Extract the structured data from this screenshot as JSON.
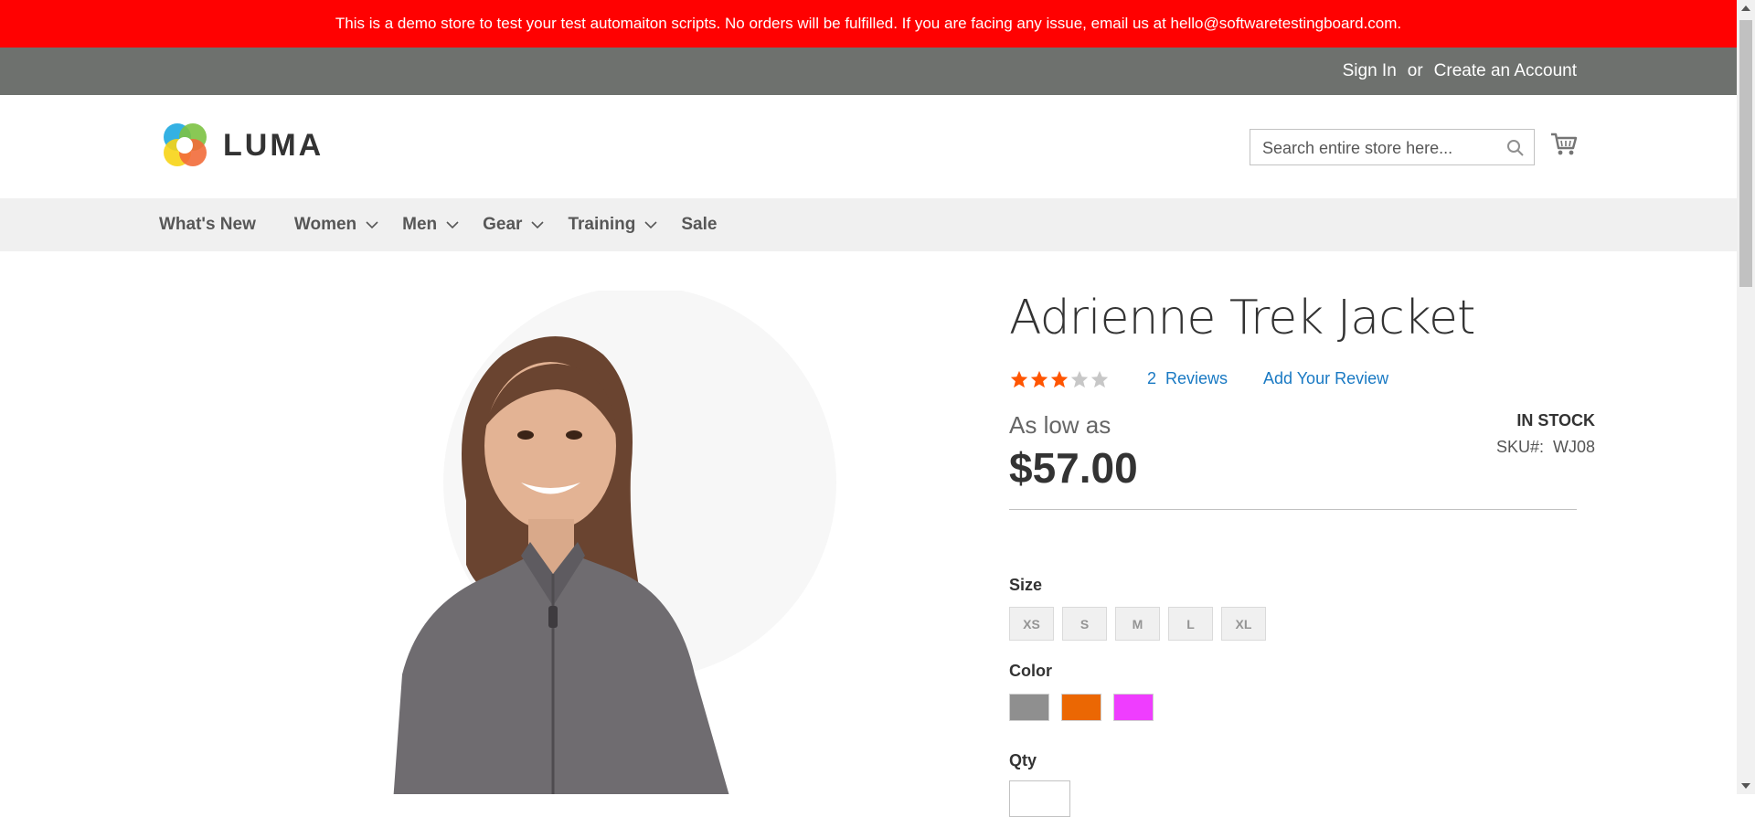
{
  "banner": {
    "text": "This is a demo store to test your test automaiton scripts. No orders will be fulfilled. If you are facing any issue, email us at hello@softwaretestingboard.com.",
    "bg_color": "#ff0101"
  },
  "top_bar": {
    "sign_in": "Sign In",
    "or": "or",
    "create_account": "Create an Account",
    "bg_color": "#6e716e"
  },
  "header": {
    "logo_text": "LUMA",
    "search": {
      "placeholder": "Search entire store here..."
    },
    "icons": [
      "luma-logo-icon",
      "search-icon",
      "cart-icon"
    ]
  },
  "nav": {
    "items": [
      {
        "label": "What's New"
      },
      {
        "label": "Women"
      },
      {
        "label": "Men"
      },
      {
        "label": "Gear"
      },
      {
        "label": "Training"
      },
      {
        "label": "Sale"
      }
    ]
  },
  "product": {
    "title": "Adrienne Trek Jacket",
    "rating": {
      "filled": 3,
      "out_of": 5,
      "star_color": "#ff5501"
    },
    "reviews_count": "2",
    "reviews_label": "Reviews",
    "add_review": "Add Your Review",
    "as_low_as": "As low as",
    "price": "$57.00",
    "stock": "In stock",
    "sku_label": "SKU#:",
    "sku": "WJ08"
  },
  "options": {
    "size_label": "Size",
    "sizes": [
      "XS",
      "S",
      "M",
      "L",
      "XL"
    ],
    "color_label": "Color",
    "colors": [
      "#8f8f8f",
      "#eb6703",
      "#ef3dff"
    ],
    "qty_label": "Qty"
  },
  "link_color": "#1979c3"
}
